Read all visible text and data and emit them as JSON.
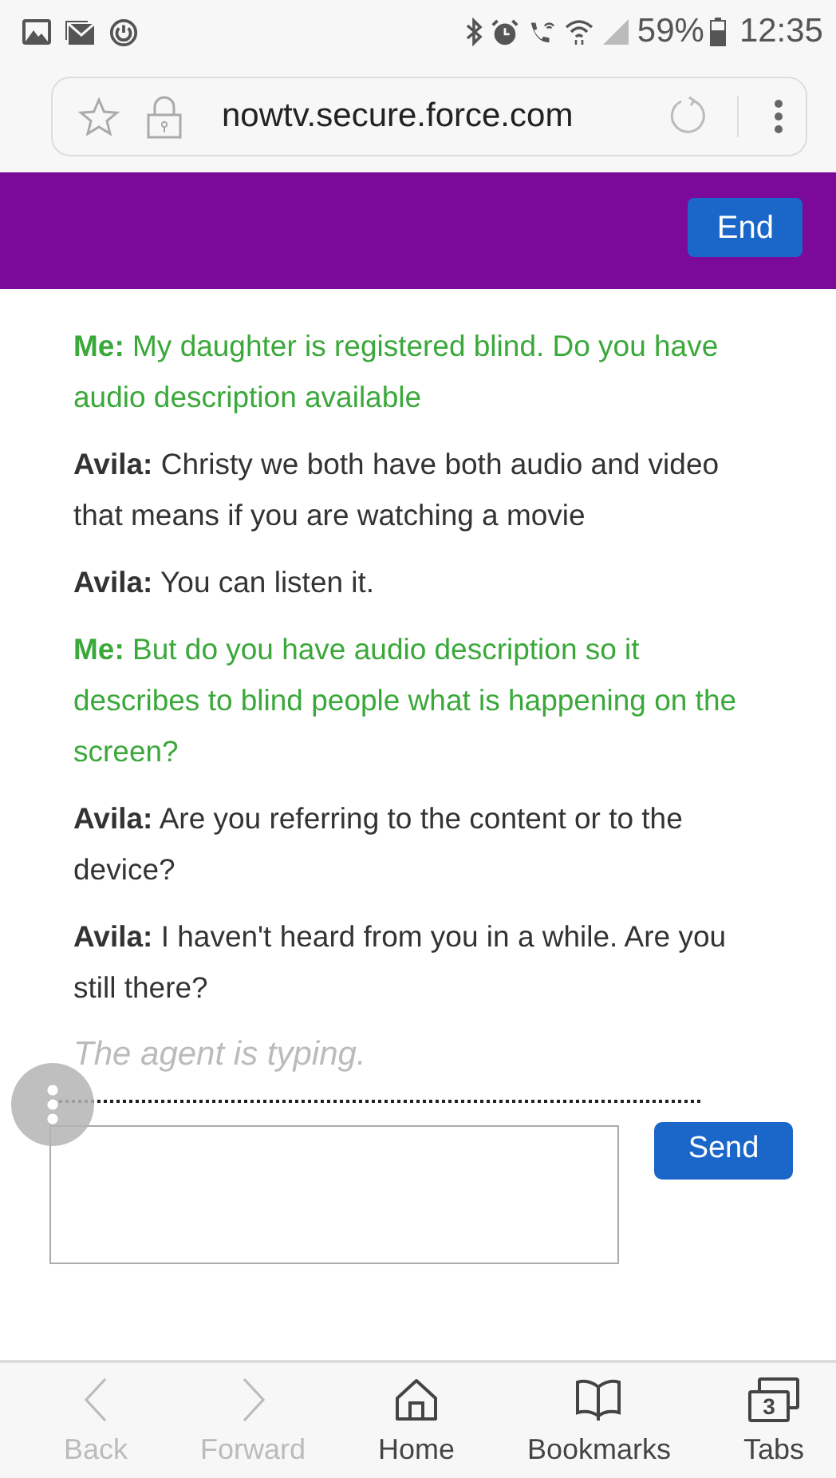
{
  "status_bar": {
    "battery": "59%",
    "time": "12:35"
  },
  "address_bar": {
    "url": "nowtv.secure.force.com"
  },
  "header": {
    "end_button": "End"
  },
  "messages": [
    {
      "kind": "me",
      "name": "Me:",
      "text": "My daughter is registered blind. Do you have audio description available"
    },
    {
      "kind": "agent",
      "name": "Avila:",
      "text": "Christy we both have both audio and video that means if you are watching a movie"
    },
    {
      "kind": "agent",
      "name": "Avila:",
      "text": "You can listen it."
    },
    {
      "kind": "me",
      "name": "Me:",
      "text": "But do you have audio description so it describes to blind people what is happening on the screen?"
    },
    {
      "kind": "agent",
      "name": "Avila:",
      "text": "Are you referring to the content or to the device?"
    },
    {
      "kind": "agent",
      "name": "Avila:",
      "text": "I haven't heard from you in a while. Are you still there?"
    }
  ],
  "typing_indicator": "The agent is typing.",
  "composer": {
    "send_button": "Send"
  },
  "bottom_nav": [
    {
      "kind": "back",
      "label": "Back",
      "disabled": true
    },
    {
      "kind": "forward",
      "label": "Forward",
      "disabled": true
    },
    {
      "kind": "home",
      "label": "Home",
      "disabled": false
    },
    {
      "kind": "bookmarks",
      "label": "Bookmarks",
      "disabled": false
    },
    {
      "kind": "tabs",
      "label": "Tabs",
      "disabled": false,
      "count": "3"
    }
  ]
}
